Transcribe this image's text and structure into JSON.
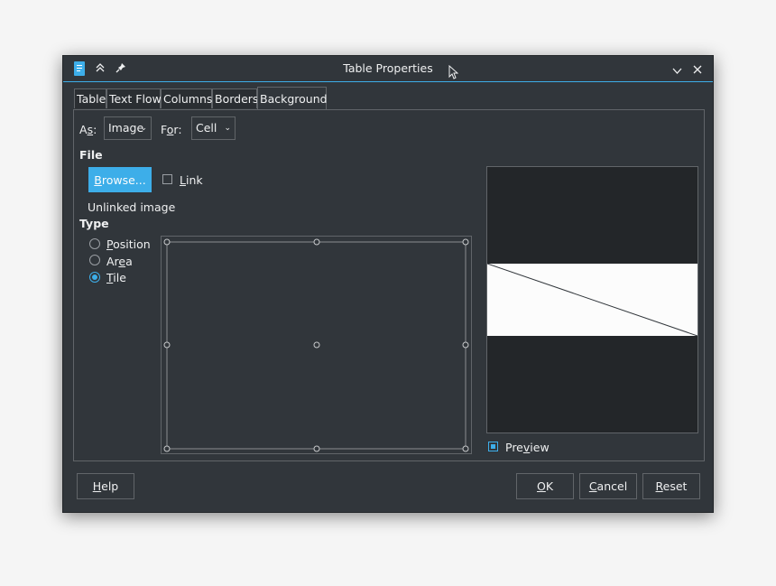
{
  "window": {
    "title": "Table Properties"
  },
  "tabs": [
    {
      "label": "Table"
    },
    {
      "label": "Text Flow"
    },
    {
      "label": "Columns"
    },
    {
      "label": "Borders"
    },
    {
      "label": "Background",
      "active": true
    }
  ],
  "as": {
    "label_pre": "A",
    "label_mn": "s",
    "label_post": ":",
    "value": "Image"
  },
  "for": {
    "label_pre": "F",
    "label_mn": "o",
    "label_post": "r:",
    "value": "Cell"
  },
  "file": {
    "heading": "File",
    "browse_mn": "B",
    "browse_rest": "rowse...",
    "link_mn": "L",
    "link_rest": "ink",
    "link_checked": false,
    "status": "Unlinked image"
  },
  "type": {
    "heading": "Type",
    "options": [
      {
        "mn": "P",
        "rest": "osition",
        "pre": "",
        "checked": false
      },
      {
        "pre": "Ar",
        "mn": "e",
        "rest": "a",
        "checked": false
      },
      {
        "mn": "T",
        "rest": "ile",
        "pre": "",
        "checked": true
      }
    ]
  },
  "preview": {
    "pre": "Pre",
    "mn": "v",
    "rest": "iew",
    "checked": true
  },
  "buttons": {
    "help": {
      "mn": "H",
      "rest": "elp"
    },
    "ok": {
      "mn": "O",
      "rest": "K"
    },
    "cancel": {
      "mn": "C",
      "rest": "ancel"
    },
    "reset": {
      "mn": "R",
      "rest": "eset"
    }
  },
  "colors": {
    "accent": "#3daee9",
    "window_bg": "#31363b",
    "border": "#616569"
  }
}
